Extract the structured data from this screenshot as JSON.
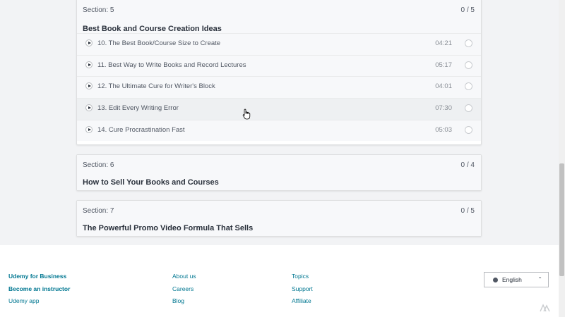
{
  "sections": [
    {
      "label": "Section: 5",
      "progress": "0 / 5",
      "title": "Best Book and Course Creation Ideas",
      "lectures": [
        {
          "title": "10. The Best Book/Course Size to Create",
          "duration": "04:21"
        },
        {
          "title": "11. Best Way to Write Books and Record Lectures",
          "duration": "05:17"
        },
        {
          "title": "12. The Ultimate Cure for Writer's Block",
          "duration": "04:01"
        },
        {
          "title": "13. Edit Every Writing Error",
          "duration": "07:30"
        },
        {
          "title": "14. Cure Procrastination Fast",
          "duration": "05:03"
        }
      ]
    },
    {
      "label": "Section: 6",
      "progress": "0 / 4",
      "title": "How to Sell Your Books and Courses"
    },
    {
      "label": "Section: 7",
      "progress": "0 / 5",
      "title": "The Powerful Promo Video Formula That Sells"
    }
  ],
  "footer": {
    "col1": [
      "Udemy for Business",
      "Become an instructor",
      "Udemy app"
    ],
    "col2": [
      "About us",
      "Careers",
      "Blog"
    ],
    "col3": [
      "Topics",
      "Support",
      "Affiliate"
    ],
    "language": "English"
  },
  "icons": {
    "play": "play-circle-icon",
    "check": "completion-circle-icon",
    "globe": "globe-icon",
    "chevron": "chevron-up-icon",
    "cursor": "hand-pointer-cursor"
  },
  "colors": {
    "link": "#007791",
    "text": "#29303b",
    "muted": "#505763",
    "background": "#f2f3f5"
  }
}
